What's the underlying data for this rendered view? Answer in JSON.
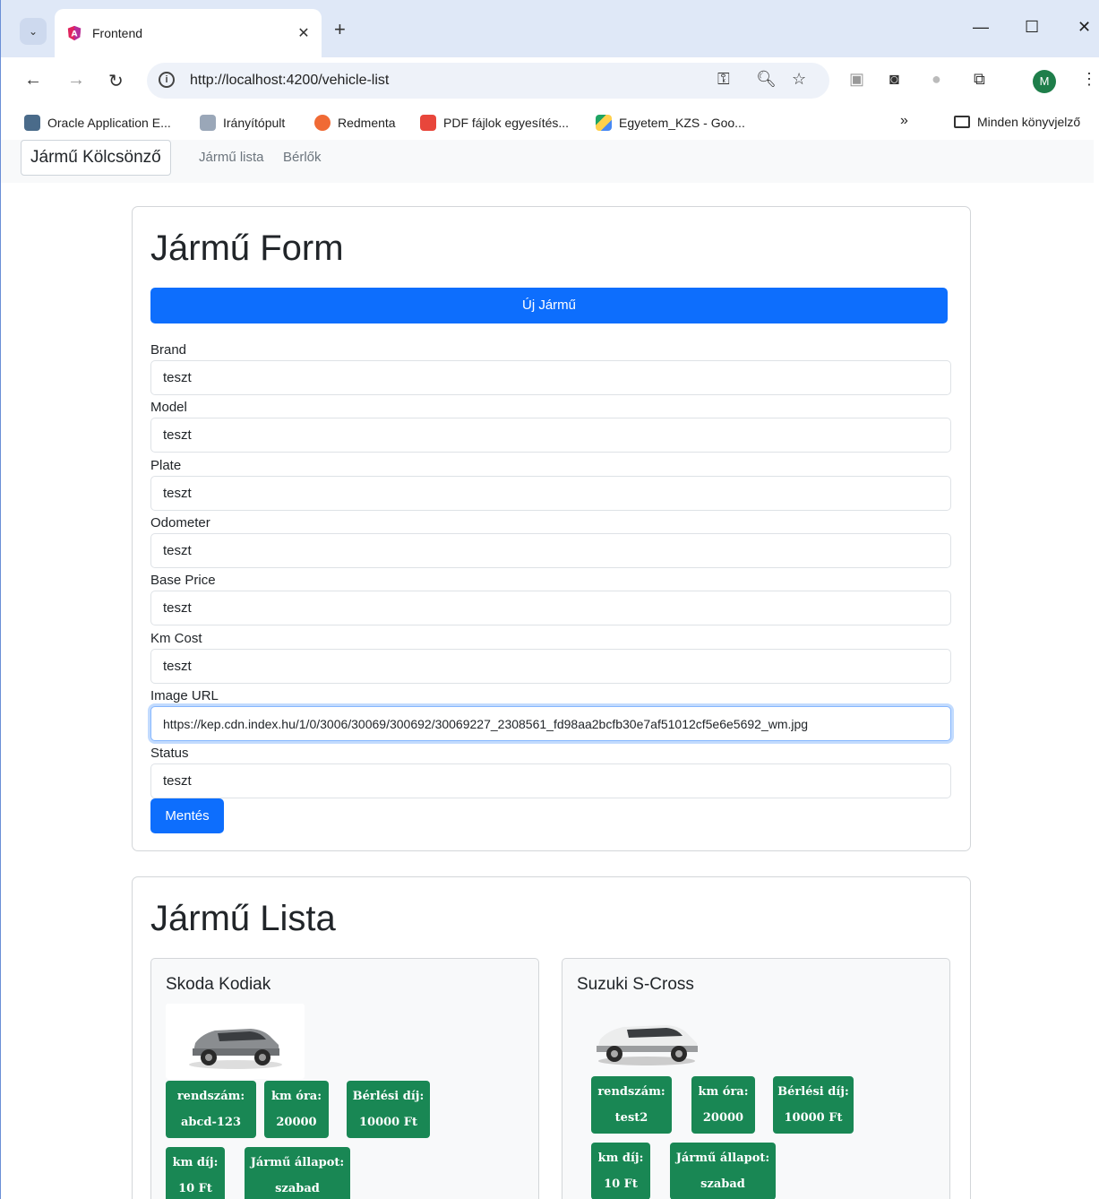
{
  "browser": {
    "tab_title": "Frontend",
    "url": "http://localhost:4200/vehicle-list",
    "profile_initial": "M",
    "bookmarks": [
      "Oracle Application E...",
      "Irányítópult",
      "Redmenta",
      "PDF fájlok egyesítés...",
      "Egyetem_KZS - Goo...",
      "Minden könyvjelző"
    ],
    "bookmarks_more": "»"
  },
  "app_nav": {
    "brand": "Jármű Kölcsönző",
    "links": [
      "Jármű lista",
      "Bérlők"
    ]
  },
  "form": {
    "title": "Jármű Form",
    "new_button": "Új Jármű",
    "fields": [
      {
        "label": "Brand",
        "value": "teszt"
      },
      {
        "label": "Model",
        "value": "teszt"
      },
      {
        "label": "Plate",
        "value": "teszt"
      },
      {
        "label": "Odometer",
        "value": "teszt"
      },
      {
        "label": "Base Price",
        "value": "teszt"
      },
      {
        "label": "Km Cost",
        "value": "teszt"
      },
      {
        "label": "Image URL",
        "value": "https://kep.cdn.index.hu/1/0/3006/30069/300692/30069227_2308561_fd98aa2bcfb30e7af51012cf5e6e5692_wm.jpg"
      },
      {
        "label": "Status",
        "value": "teszt"
      }
    ],
    "save_button": "Mentés"
  },
  "list": {
    "title": "Jármű Lista",
    "vehicles": [
      {
        "name": "Skoda Kodiak",
        "badges": [
          {
            "label": "rendszám:",
            "value": "abcd-123"
          },
          {
            "label": "km óra:",
            "value": "20000"
          },
          {
            "label": "Bérlési díj:",
            "value": "10000 Ft"
          },
          {
            "label": "km díj:",
            "value": "10 Ft"
          },
          {
            "label": "Jármű állapot:",
            "value": "szabad"
          }
        ]
      },
      {
        "name": "Suzuki S-Cross",
        "badges": [
          {
            "label": "rendszám:",
            "value": "test2"
          },
          {
            "label": "km óra:",
            "value": "20000"
          },
          {
            "label": "Bérlési díj:",
            "value": "10000 Ft"
          },
          {
            "label": "km díj:",
            "value": "10 Ft"
          },
          {
            "label": "Jármű állapot:",
            "value": "szabad"
          }
        ]
      }
    ]
  },
  "colors": {
    "primary": "#0d6efd",
    "success": "#198754",
    "chrome_tab_bg": "#dfe8f7"
  }
}
